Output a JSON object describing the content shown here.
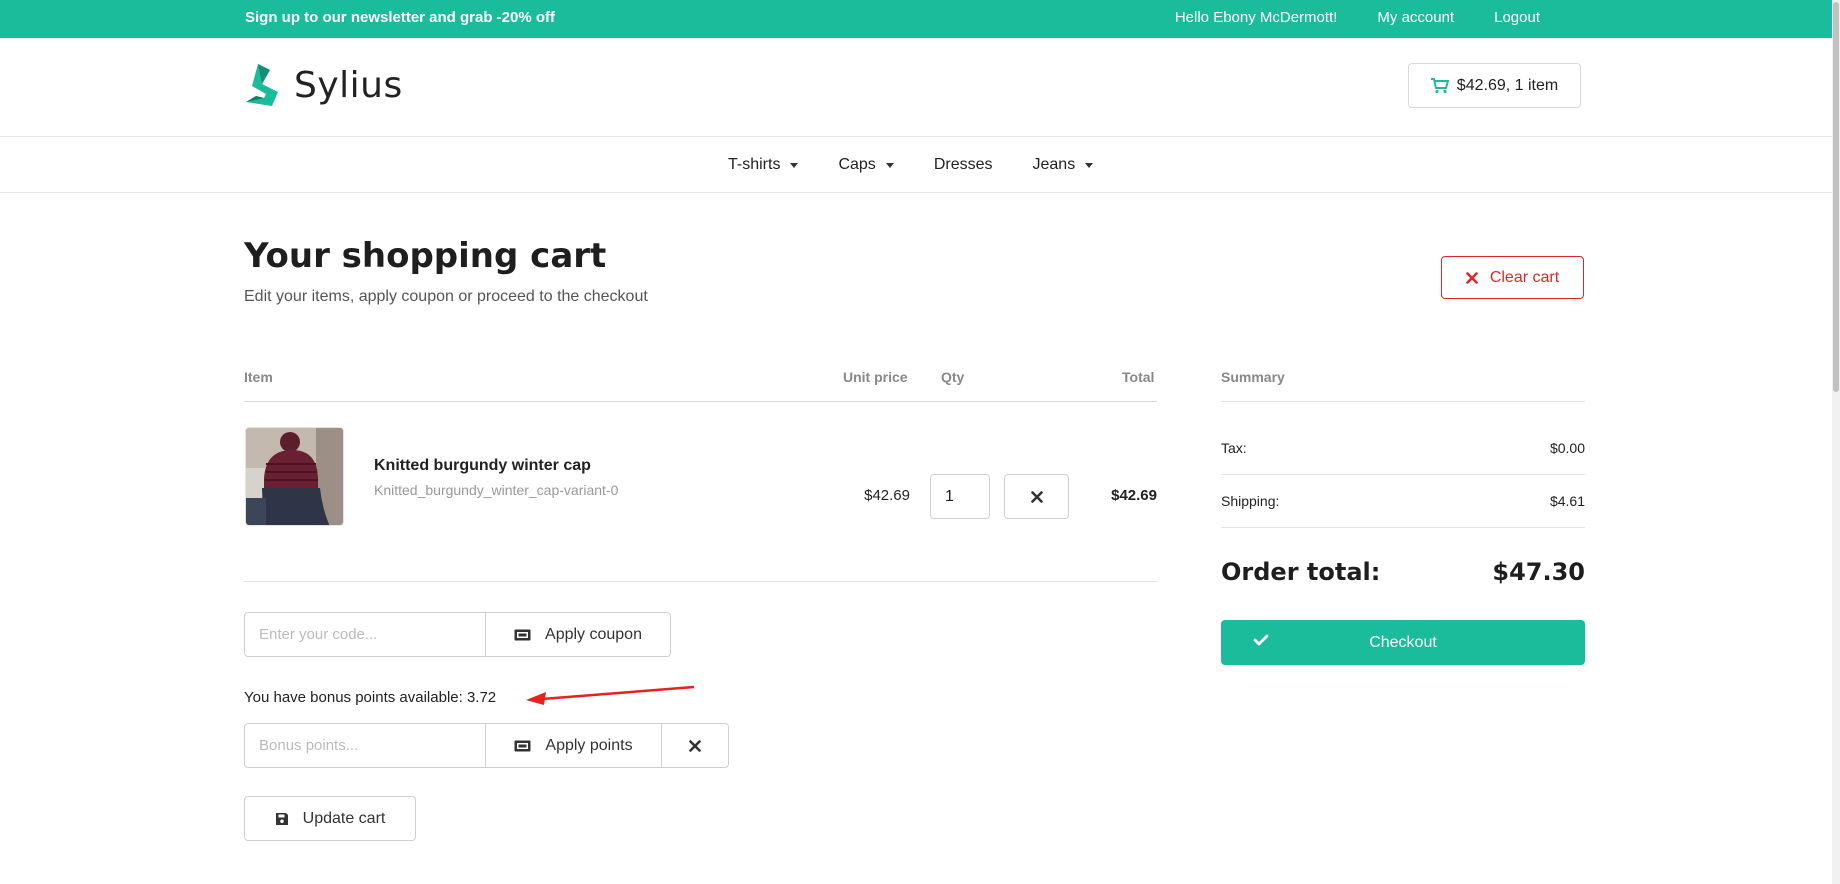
{
  "topbar": {
    "promo": "Sign up to our newsletter and grab -20% off",
    "greeting": "Hello Ebony McDermott!",
    "my_account": "My account",
    "logout": "Logout"
  },
  "header": {
    "logo_text": "Sylius",
    "cart_summary": "$42.69, 1 item"
  },
  "nav": {
    "items": [
      {
        "label": "T-shirts",
        "dropdown": true
      },
      {
        "label": "Caps",
        "dropdown": true
      },
      {
        "label": "Dresses",
        "dropdown": false
      },
      {
        "label": "Jeans",
        "dropdown": true
      }
    ]
  },
  "page": {
    "title": "Your shopping cart",
    "subtitle": "Edit your items, apply coupon or proceed to the checkout",
    "clear_cart": "Clear cart"
  },
  "table": {
    "headers": {
      "item": "Item",
      "unit_price": "Unit price",
      "qty": "Qty",
      "total": "Total"
    },
    "rows": [
      {
        "name": "Knitted burgundy winter cap",
        "variant": "Knitted_burgundy_winter_cap-variant-0",
        "unit_price": "$42.69",
        "qty": "1",
        "total": "$42.69"
      }
    ]
  },
  "coupon": {
    "placeholder": "Enter your code...",
    "apply_label": "Apply coupon"
  },
  "bonus": {
    "available_text": "You have bonus points available: 3.72",
    "placeholder": "Bonus points...",
    "apply_label": "Apply points"
  },
  "update_cart": "Update cart",
  "summary": {
    "heading": "Summary",
    "tax_label": "Tax:",
    "tax_value": "$0.00",
    "shipping_label": "Shipping:",
    "shipping_value": "$4.61",
    "order_total_label": "Order total:",
    "order_total_value": "$47.30",
    "checkout_label": "Checkout"
  },
  "colors": {
    "brand": "#1abc9c",
    "danger": "#db2828",
    "annotation": "#e8211c"
  },
  "icons": [
    "cart-icon",
    "caret-down-icon",
    "close-icon",
    "ticket-icon",
    "save-icon",
    "check-icon",
    "logo-icon"
  ]
}
